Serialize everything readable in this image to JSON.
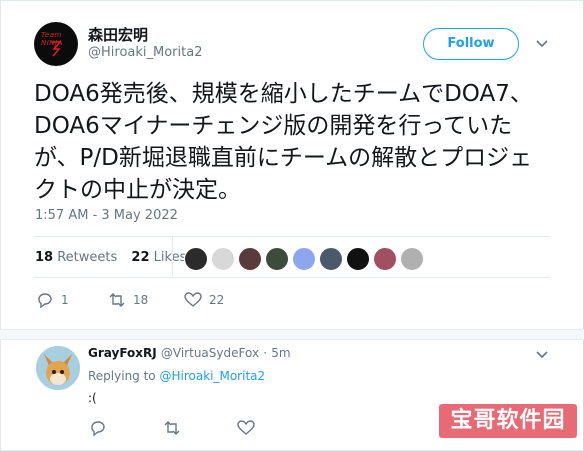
{
  "tweet": {
    "author_name": "森田宏明",
    "author_handle": "@Hiroaki_Morita2",
    "follow_label": "Follow",
    "avatar_text": "Team NINJA",
    "text": "DOA6発売後、規模を縮小したチームでDOA7、DOA6マイナーチェンジ版の開発を行っていたが、P/D新堀退職直前にチームの解散とプロジェクトの中止が決定。",
    "timestamp": "1:57 AM - 3 May 2022",
    "retweets_count": "18",
    "retweets_label": "Retweets",
    "likes_count": "22",
    "likes_label": "Likes",
    "actions": {
      "reply_count": "1",
      "retweet_count": "18",
      "like_count": "22"
    }
  },
  "likers": [
    {
      "color": "#2b2b2b"
    },
    {
      "color": "#d8d8d8"
    },
    {
      "color": "#5a3a3a"
    },
    {
      "color": "#3d4b3d"
    },
    {
      "color": "#8ea6f0"
    },
    {
      "color": "#4a5a6a"
    },
    {
      "color": "#111111"
    },
    {
      "color": "#a05060"
    },
    {
      "color": "#b0b0b0"
    }
  ],
  "reply": {
    "author_name": "GrayFoxRJ",
    "author_handle": "@VirtuaSydeFox",
    "time": "5m",
    "replying_prefix": "Replying to",
    "replying_to": "@Hiroaki_Morita2",
    "text": ":("
  },
  "watermark": {
    "text": "宝哥软件园"
  },
  "colors": {
    "accent": "#1da1f2",
    "secondary": "#657786",
    "watermark_bg": "#e86a74"
  }
}
